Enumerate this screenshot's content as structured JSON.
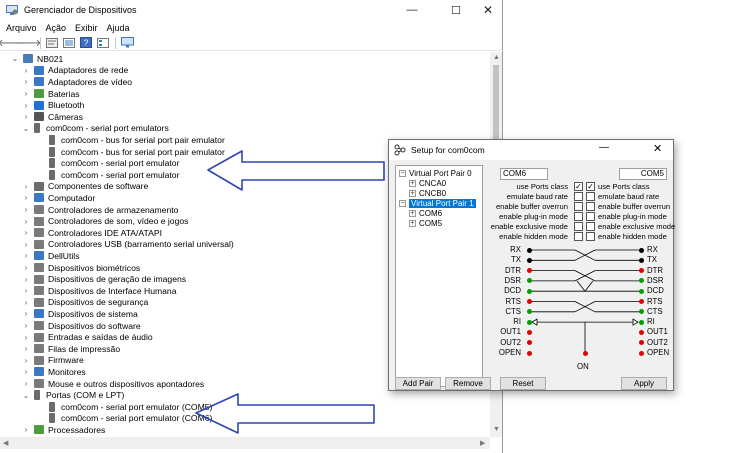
{
  "device_manager": {
    "title": "Gerenciador de Dispositivos",
    "menu": [
      "Arquivo",
      "Ação",
      "Exibir",
      "Ajuda"
    ],
    "tree": [
      {
        "label": "NB021",
        "level": 0,
        "chev": "⌄",
        "icon": "computer-icon",
        "color": "#4a7bb7"
      },
      {
        "label": "Adaptadores de rede",
        "level": 1,
        "chev": "›",
        "icon": "network-adapter-icon",
        "color": "#3b78c4"
      },
      {
        "label": "Adaptadores de vídeo",
        "level": 1,
        "chev": "›",
        "icon": "display-adapter-icon",
        "color": "#3b78c4"
      },
      {
        "label": "Baterias",
        "level": 1,
        "chev": "›",
        "icon": "battery-icon",
        "color": "#4f9a3a"
      },
      {
        "label": "Bluetooth",
        "level": 1,
        "chev": "›",
        "icon": "bluetooth-icon",
        "color": "#1f6fd6"
      },
      {
        "label": "Câmeras",
        "level": 1,
        "chev": "›",
        "icon": "camera-icon",
        "color": "#555555"
      },
      {
        "label": "com0com - serial port emulators",
        "level": 1,
        "chev": "⌄",
        "icon": "port-icon",
        "color": "#6b6b6b"
      },
      {
        "label": "com0com - bus for serial port pair emulator",
        "level": 2,
        "chev": "",
        "icon": "port-icon",
        "color": "#6b6b6b"
      },
      {
        "label": "com0com - bus for serial port pair emulator",
        "level": 2,
        "chev": "",
        "icon": "port-icon",
        "color": "#6b6b6b"
      },
      {
        "label": "com0com - serial port emulator",
        "level": 2,
        "chev": "",
        "icon": "port-icon",
        "color": "#6b6b6b"
      },
      {
        "label": "com0com - serial port emulator",
        "level": 2,
        "chev": "",
        "icon": "port-icon",
        "color": "#6b6b6b"
      },
      {
        "label": "Componentes de software",
        "level": 1,
        "chev": "›",
        "icon": "software-component-icon",
        "color": "#6d6d6d"
      },
      {
        "label": "Computador",
        "level": 1,
        "chev": "›",
        "icon": "computer-icon",
        "color": "#3b78c4"
      },
      {
        "label": "Controladores de armazenamento",
        "level": 1,
        "chev": "›",
        "icon": "storage-controller-icon",
        "color": "#7a7a7a"
      },
      {
        "label": "Controladores de som, vídeo e jogos",
        "level": 1,
        "chev": "›",
        "icon": "sound-icon",
        "color": "#7a7a7a"
      },
      {
        "label": "Controladores IDE ATA/ATAPI",
        "level": 1,
        "chev": "›",
        "icon": "ide-controller-icon",
        "color": "#7a7a7a"
      },
      {
        "label": "Controladores USB (barramento serial universal)",
        "level": 1,
        "chev": "›",
        "icon": "usb-icon",
        "color": "#7a7a7a"
      },
      {
        "label": "DellUtils",
        "level": 1,
        "chev": "›",
        "icon": "device-icon",
        "color": "#3b78c4"
      },
      {
        "label": "Dispositivos biométricos",
        "level": 1,
        "chev": "›",
        "icon": "biometric-icon",
        "color": "#7a7a7a"
      },
      {
        "label": "Dispositivos de geração de imagens",
        "level": 1,
        "chev": "›",
        "icon": "imaging-icon",
        "color": "#7a7a7a"
      },
      {
        "label": "Dispositivos de Interface Humana",
        "level": 1,
        "chev": "›",
        "icon": "hid-icon",
        "color": "#7a7a7a"
      },
      {
        "label": "Dispositivos de segurança",
        "level": 1,
        "chev": "›",
        "icon": "security-device-icon",
        "color": "#7a7a7a"
      },
      {
        "label": "Dispositivos de sistema",
        "level": 1,
        "chev": "›",
        "icon": "system-device-icon",
        "color": "#3b78c4"
      },
      {
        "label": "Dispositivos do software",
        "level": 1,
        "chev": "›",
        "icon": "software-device-icon",
        "color": "#7a7a7a"
      },
      {
        "label": "Entradas e saídas de áudio",
        "level": 1,
        "chev": "›",
        "icon": "audio-io-icon",
        "color": "#7a7a7a"
      },
      {
        "label": "Filas de impressão",
        "level": 1,
        "chev": "›",
        "icon": "print-queue-icon",
        "color": "#7a7a7a"
      },
      {
        "label": "Firmware",
        "level": 1,
        "chev": "›",
        "icon": "firmware-icon",
        "color": "#7a7a7a"
      },
      {
        "label": "Monitores",
        "level": 1,
        "chev": "›",
        "icon": "monitor-icon",
        "color": "#3b78c4"
      },
      {
        "label": "Mouse e outros dispositivos apontadores",
        "level": 1,
        "chev": "›",
        "icon": "mouse-icon",
        "color": "#7a7a7a"
      },
      {
        "label": "Portas (COM e LPT)",
        "level": 1,
        "chev": "⌄",
        "icon": "port-icon",
        "color": "#6b6b6b"
      },
      {
        "label": "com0com - serial port emulator (COM5)",
        "level": 2,
        "chev": "",
        "icon": "port-icon",
        "color": "#6b6b6b"
      },
      {
        "label": "com0com - serial port emulator (COM6)",
        "level": 2,
        "chev": "",
        "icon": "port-icon",
        "color": "#6b6b6b"
      },
      {
        "label": "Processadores",
        "level": 1,
        "chev": "›",
        "icon": "processor-icon",
        "color": "#4f9a3a"
      }
    ]
  },
  "setup": {
    "title": "Setup for com0com",
    "tree": {
      "pair0": "Virtual Port Pair 0",
      "pair0_children": [
        "CNCA0",
        "CNCB0"
      ],
      "pair1": "Virtual Port Pair 1",
      "pair1_children": [
        "COM6",
        "COM5"
      ]
    },
    "port_a": "COM6",
    "port_b": "COM5",
    "options": [
      {
        "label": "use Ports class",
        "a": true,
        "b": true
      },
      {
        "label": "emulate baud rate",
        "a": false,
        "b": false
      },
      {
        "label": "enable buffer overrun",
        "a": false,
        "b": false
      },
      {
        "label": "enable plug-in mode",
        "a": false,
        "b": false
      },
      {
        "label": "enable exclusive mode",
        "a": false,
        "b": false
      },
      {
        "label": "enable hidden mode",
        "a": false,
        "b": false
      }
    ],
    "signals_a": [
      {
        "name": "RX",
        "color": "#000000"
      },
      {
        "name": "TX",
        "color": "#000000"
      },
      {
        "name": "DTR",
        "color": "#e00000"
      },
      {
        "name": "DSR",
        "color": "#00a000"
      },
      {
        "name": "DCD",
        "color": "#00a000"
      },
      {
        "name": "RTS",
        "color": "#e00000"
      },
      {
        "name": "CTS",
        "color": "#00a000"
      },
      {
        "name": "RI",
        "color": "#00a000"
      },
      {
        "name": "OUT1",
        "color": "#e00000"
      },
      {
        "name": "OUT2",
        "color": "#e00000"
      },
      {
        "name": "OPEN",
        "color": "#e00000"
      }
    ],
    "signals_b": [
      {
        "name": "RX",
        "color": "#000000"
      },
      {
        "name": "TX",
        "color": "#000000"
      },
      {
        "name": "DTR",
        "color": "#e00000"
      },
      {
        "name": "DSR",
        "color": "#00a000"
      },
      {
        "name": "DCD",
        "color": "#00a000"
      },
      {
        "name": "RTS",
        "color": "#e00000"
      },
      {
        "name": "CTS",
        "color": "#00a000"
      },
      {
        "name": "RI",
        "color": "#00a000"
      },
      {
        "name": "OUT1",
        "color": "#e00000"
      },
      {
        "name": "OUT2",
        "color": "#e00000"
      },
      {
        "name": "OPEN",
        "color": "#e00000"
      }
    ],
    "on_label": "ON",
    "buttons": {
      "add_pair": "Add Pair",
      "remove": "Remove",
      "reset": "Reset",
      "apply": "Apply"
    }
  },
  "colors": {
    "arrow": "#2f45b3",
    "selection": "#0078d7",
    "checkmark": "#333333"
  }
}
